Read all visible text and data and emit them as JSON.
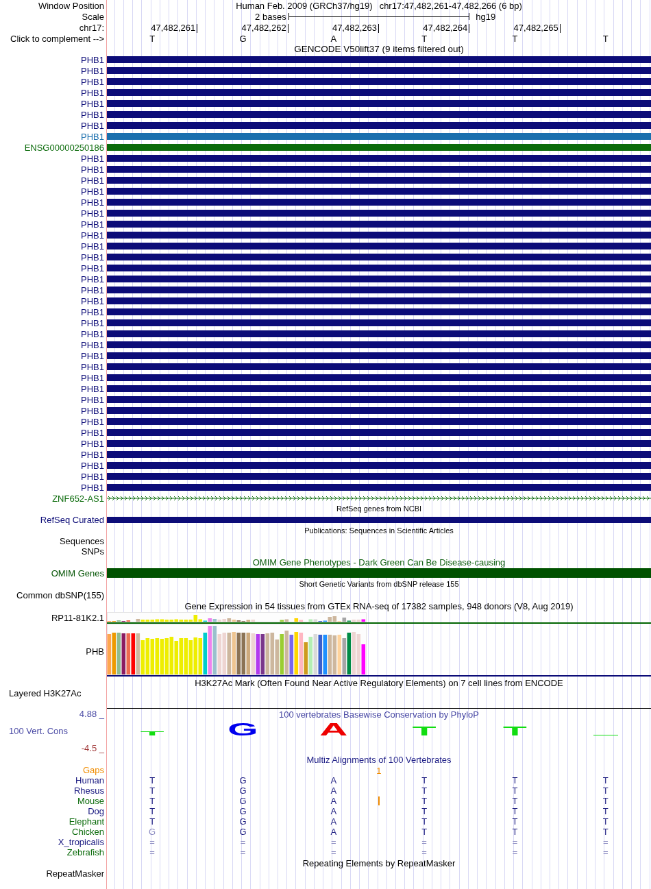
{
  "position": {
    "label": "Window Position",
    "assembly": "Human Feb. 2009 (GRCh37/hg19)",
    "range": "chr17:47,482,261-47,482,266 (6 bp)"
  },
  "scale": {
    "label": "Scale",
    "span": "2 bases",
    "assembly": "hg19"
  },
  "ruler": {
    "label": "chr17:",
    "ticks": [
      "47,482,261",
      "47,482,262",
      "47,482,263",
      "47,482,264",
      "47,482,265"
    ]
  },
  "sequence": {
    "label": "Click to complement -->",
    "bases": [
      "T",
      "G",
      "A",
      "T",
      "T",
      "T"
    ]
  },
  "gencode": {
    "title": "GENCODE V50lift37 (9 items filtered out)",
    "items": [
      {
        "label": "PHB1",
        "kind": "bar",
        "color": "#0c0c78"
      },
      {
        "label": "PHB1",
        "kind": "bar",
        "color": "#0c0c78"
      },
      {
        "label": "PHB1",
        "kind": "bar",
        "color": "#0c0c78"
      },
      {
        "label": "PHB1",
        "kind": "bar",
        "color": "#0c0c78"
      },
      {
        "label": "PHB1",
        "kind": "bar",
        "color": "#0c0c78"
      },
      {
        "label": "PHB1",
        "kind": "bar",
        "color": "#0c0c78"
      },
      {
        "label": "PHB1",
        "kind": "bar",
        "color": "#0c0c78"
      },
      {
        "label": "PHB1",
        "kind": "bar",
        "color": "#1a6fae"
      },
      {
        "label": "ENSG00000250186",
        "kind": "bar",
        "color": "#0b6b0b"
      },
      {
        "label": "PHB1",
        "kind": "bar",
        "color": "#0c0c78"
      },
      {
        "label": "PHB1",
        "kind": "bar",
        "color": "#0c0c78"
      },
      {
        "label": "PHB1",
        "kind": "bar",
        "color": "#0c0c78"
      },
      {
        "label": "PHB1",
        "kind": "bar",
        "color": "#0c0c78"
      },
      {
        "label": "PHB1",
        "kind": "bar",
        "color": "#0c0c78"
      },
      {
        "label": "PHB1",
        "kind": "bar",
        "color": "#0c0c78"
      },
      {
        "label": "PHB1",
        "kind": "bar",
        "color": "#0c0c78"
      },
      {
        "label": "PHB1",
        "kind": "bar",
        "color": "#0c0c78"
      },
      {
        "label": "PHB1",
        "kind": "bar",
        "color": "#0c0c78"
      },
      {
        "label": "PHB1",
        "kind": "bar",
        "color": "#0c0c78"
      },
      {
        "label": "PHB1",
        "kind": "bar",
        "color": "#0c0c78"
      },
      {
        "label": "PHB1",
        "kind": "bar",
        "color": "#0c0c78"
      },
      {
        "label": "PHB1",
        "kind": "bar",
        "color": "#0c0c78"
      },
      {
        "label": "PHB1",
        "kind": "bar",
        "color": "#0c0c78"
      },
      {
        "label": "PHB1",
        "kind": "bar",
        "color": "#0c0c78"
      },
      {
        "label": "PHB1",
        "kind": "bar",
        "color": "#0c0c78"
      },
      {
        "label": "PHB1",
        "kind": "bar",
        "color": "#0c0c78"
      },
      {
        "label": "PHB1",
        "kind": "bar",
        "color": "#0c0c78"
      },
      {
        "label": "PHB1",
        "kind": "bar",
        "color": "#0c0c78"
      },
      {
        "label": "PHB1",
        "kind": "bar",
        "color": "#0c0c78"
      },
      {
        "label": "PHB1",
        "kind": "bar",
        "color": "#0c0c78"
      },
      {
        "label": "PHB1",
        "kind": "bar",
        "color": "#0c0c78"
      },
      {
        "label": "PHB1",
        "kind": "bar",
        "color": "#0c0c78"
      },
      {
        "label": "PHB1",
        "kind": "bar",
        "color": "#0c0c78"
      },
      {
        "label": "PHB1",
        "kind": "bar",
        "color": "#0c0c78"
      },
      {
        "label": "PHB1",
        "kind": "bar",
        "color": "#0c0c78"
      },
      {
        "label": "PHB1",
        "kind": "bar",
        "color": "#0c0c78"
      },
      {
        "label": "PHB1",
        "kind": "bar",
        "color": "#0c0c78"
      },
      {
        "label": "PHB1",
        "kind": "bar",
        "color": "#0c0c78"
      },
      {
        "label": "PHB1",
        "kind": "bar",
        "color": "#0c0c78"
      },
      {
        "label": "PHB1",
        "kind": "bar",
        "color": "#0c0c78"
      },
      {
        "label": "ZNF652-AS1",
        "kind": "strand_line",
        "color": "#0b6b0b"
      }
    ]
  },
  "refseq": {
    "title": "RefSeq genes from NCBI",
    "items": [
      {
        "label": "RefSeq Curated",
        "kind": "bar",
        "color": "#0c0c78"
      }
    ]
  },
  "publications": {
    "title": "Publications: Sequences in Scientific Articles",
    "items": [
      {
        "label": "Sequences"
      },
      {
        "label": "SNPs"
      }
    ]
  },
  "omim": {
    "title": "OMIM Gene Phenotypes - Dark Green Can Be Disease-causing",
    "items": [
      {
        "label": "OMIM Genes",
        "kind": "bar",
        "color": "#005200"
      }
    ]
  },
  "dbsnp": {
    "title": "Short Genetic Variants from dbSNP release 155",
    "items": [
      {
        "label": "Common dbSNP(155)"
      }
    ]
  },
  "gtex": {
    "title": "Gene Expression in 54 tissues from GTEx RNA-seq of 17382 samples, 948 donors (V8, Aug 2019)",
    "genes": [
      {
        "label": "RP11-81K2.1",
        "color": "#006400"
      },
      {
        "label": "PHB",
        "color": "#0c0c78"
      }
    ]
  },
  "h3k27ac": {
    "title": "H3K27Ac Mark (Often Found Near Active Regulatory Elements) on 7 cell lines from ENCODE",
    "label": "Layered H3K27Ac"
  },
  "phylop": {
    "title": "100 vertebrates Basewise Conservation by PhyloP",
    "label": "100 Vert. Cons",
    "axis_top": "4.88 _",
    "axis_bottom": "-4.5 _",
    "letters": [
      {
        "kind": "letter",
        "text": "T",
        "color": "#11dd11"
      },
      {
        "kind": "letter",
        "text": "G",
        "color": "#0000ee"
      },
      {
        "kind": "letter",
        "text": "A",
        "color": "#ee0000"
      },
      {
        "kind": "letter",
        "text": "T",
        "color": "#11dd11"
      },
      {
        "kind": "letter",
        "text": "T",
        "color": "#11dd11"
      },
      {
        "kind": "mark",
        "color": "#11dd11"
      }
    ]
  },
  "multiz": {
    "title": "Multiz Alignments of 100 Vertebrates",
    "gaps": {
      "label": "Gaps",
      "columns": [
        {
          "kind": "blank"
        },
        {
          "kind": "blank"
        },
        {
          "kind": "count",
          "text": "1"
        },
        {
          "kind": "blank"
        },
        {
          "kind": "blank"
        },
        {
          "kind": "blank"
        }
      ]
    },
    "species": [
      {
        "name": "Human",
        "color": "#14147e",
        "bases": [
          {
            "text": "T",
            "faint": false,
            "insertion": false
          },
          {
            "text": "G",
            "faint": false,
            "insertion": false
          },
          {
            "text": "A",
            "faint": false,
            "insertion": false
          },
          {
            "text": "T",
            "faint": false,
            "insertion": false
          },
          {
            "text": "T",
            "faint": false,
            "insertion": false
          },
          {
            "text": "T",
            "faint": false,
            "insertion": false
          }
        ]
      },
      {
        "name": "Rhesus",
        "color": "#14147e",
        "bases": [
          {
            "text": "T",
            "faint": false,
            "insertion": false
          },
          {
            "text": "G",
            "faint": false,
            "insertion": false
          },
          {
            "text": "A",
            "faint": false,
            "insertion": false
          },
          {
            "text": "T",
            "faint": false,
            "insertion": false
          },
          {
            "text": "T",
            "faint": false,
            "insertion": false
          },
          {
            "text": "T",
            "faint": false,
            "insertion": false
          }
        ]
      },
      {
        "name": "Mouse",
        "color": "#0b6b0b",
        "bases": [
          {
            "text": "T",
            "faint": false,
            "insertion": false
          },
          {
            "text": "G",
            "faint": false,
            "insertion": false
          },
          {
            "text": "A",
            "faint": false,
            "insertion": true
          },
          {
            "text": "T",
            "faint": false,
            "insertion": false
          },
          {
            "text": "T",
            "faint": false,
            "insertion": false
          },
          {
            "text": "T",
            "faint": false,
            "insertion": false
          }
        ]
      },
      {
        "name": "Dog",
        "color": "#14147e",
        "bases": [
          {
            "text": "T",
            "faint": false,
            "insertion": false
          },
          {
            "text": "G",
            "faint": false,
            "insertion": false
          },
          {
            "text": "A",
            "faint": false,
            "insertion": false
          },
          {
            "text": "T",
            "faint": false,
            "insertion": false
          },
          {
            "text": "T",
            "faint": false,
            "insertion": false
          },
          {
            "text": "T",
            "faint": false,
            "insertion": false
          }
        ]
      },
      {
        "name": "Elephant",
        "color": "#0b6b0b",
        "bases": [
          {
            "text": "T",
            "faint": false,
            "insertion": false
          },
          {
            "text": "G",
            "faint": false,
            "insertion": false
          },
          {
            "text": "A",
            "faint": false,
            "insertion": false
          },
          {
            "text": "T",
            "faint": false,
            "insertion": false
          },
          {
            "text": "T",
            "faint": false,
            "insertion": false
          },
          {
            "text": "T",
            "faint": false,
            "insertion": false
          }
        ]
      },
      {
        "name": "Chicken",
        "color": "#0b6b0b",
        "bases": [
          {
            "text": "G",
            "faint": true,
            "insertion": false
          },
          {
            "text": "G",
            "faint": false,
            "insertion": false
          },
          {
            "text": "A",
            "faint": false,
            "insertion": false
          },
          {
            "text": "T",
            "faint": false,
            "insertion": false
          },
          {
            "text": "T",
            "faint": false,
            "insertion": false
          },
          {
            "text": "T",
            "faint": false,
            "insertion": false
          }
        ]
      },
      {
        "name": "X_tropicalis",
        "color": "#14147e",
        "bases": [
          {
            "text": "=",
            "faint": true,
            "insertion": false
          },
          {
            "text": "=",
            "faint": true,
            "insertion": false
          },
          {
            "text": "=",
            "faint": true,
            "insertion": false
          },
          {
            "text": "=",
            "faint": true,
            "insertion": false
          },
          {
            "text": "=",
            "faint": true,
            "insertion": false
          },
          {
            "text": "=",
            "faint": true,
            "insertion": false
          }
        ]
      },
      {
        "name": "Zebrafish",
        "color": "#0b6b0b",
        "bases": [
          {
            "text": "=",
            "faint": true,
            "insertion": false
          },
          {
            "text": "=",
            "faint": true,
            "insertion": false
          },
          {
            "text": "=",
            "faint": true,
            "insertion": false
          },
          {
            "text": "=",
            "faint": true,
            "insertion": false
          },
          {
            "text": "=",
            "faint": true,
            "insertion": false
          },
          {
            "text": "=",
            "faint": true,
            "insertion": false
          }
        ]
      }
    ]
  },
  "repeatmasker": {
    "title": "Repeating Elements by RepeatMasker",
    "label": "RepeatMasker"
  }
}
